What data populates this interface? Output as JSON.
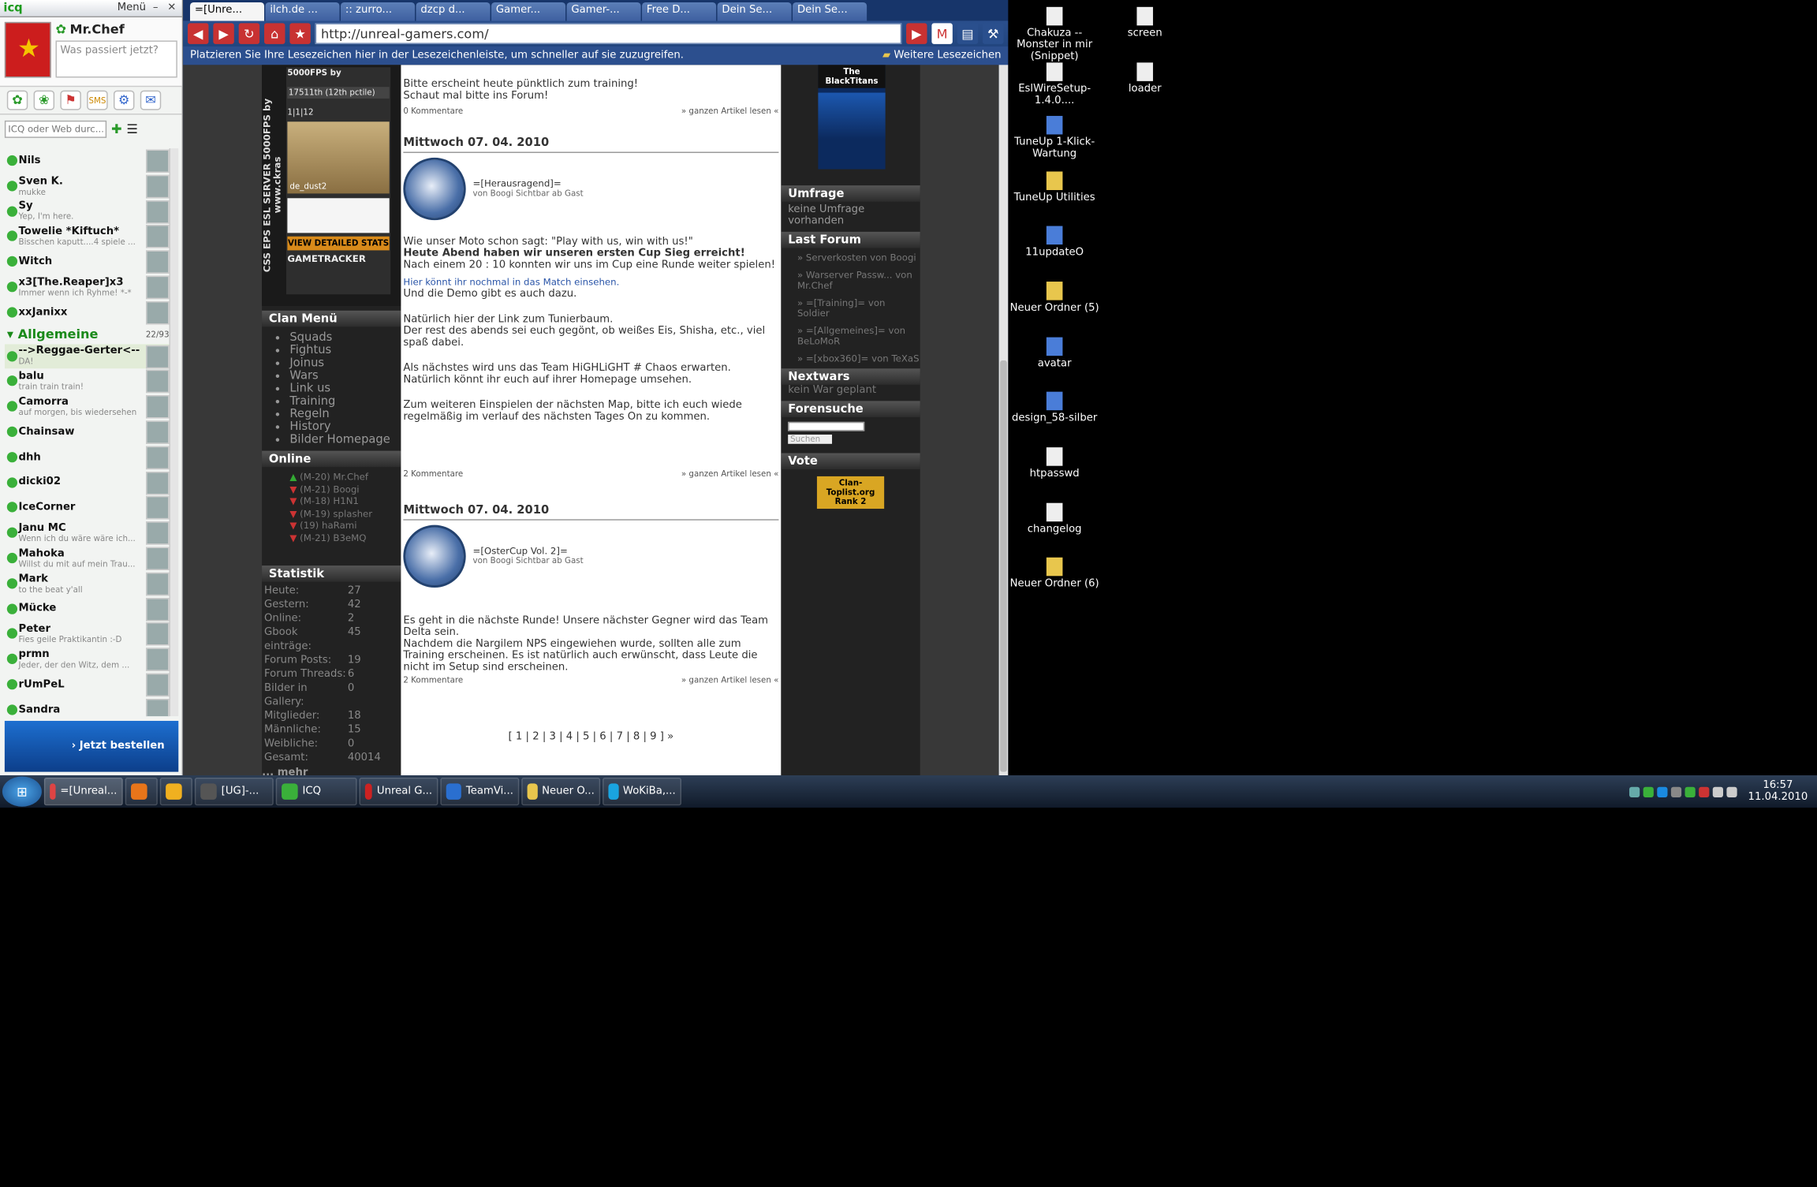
{
  "icq": {
    "logo": "icq",
    "menu_label": "Menü",
    "user_name": "Mr.Chef",
    "status_placeholder": "Was passiert jetzt?",
    "search_placeholder": "ICQ oder Web durc...",
    "contacts": [
      {
        "name": "Nils",
        "status": ""
      },
      {
        "name": "Sven K.",
        "status": "mukke"
      },
      {
        "name": "Sy",
        "status": "Yep, I'm here."
      },
      {
        "name": "Towelie *Kiftuch*",
        "status": "Bisschen kaputt....4 spiele ..."
      },
      {
        "name": "Witch",
        "status": ""
      },
      {
        "name": "x3[The.Reaper]x3",
        "status": "Immer wenn ich Ryhme! *-*"
      },
      {
        "name": "xxJanixx",
        "status": ""
      }
    ],
    "group": {
      "name": "Allgemeine",
      "count": "22/93"
    },
    "group_contacts": [
      {
        "name": "-->Reggae-Gerter<--",
        "status": "DA!"
      },
      {
        "name": "balu",
        "status": "train train train!"
      },
      {
        "name": "Camorra",
        "status": "auf morgen, bis wiedersehen"
      },
      {
        "name": "Chainsaw",
        "status": ""
      },
      {
        "name": "dhh",
        "status": ""
      },
      {
        "name": "dicki02",
        "status": ""
      },
      {
        "name": "IceCorner",
        "status": ""
      },
      {
        "name": "Janu MC",
        "status": "Wenn ich du wäre wäre ich..."
      },
      {
        "name": "Mahoka",
        "status": "Willst du mit auf mein Trau..."
      },
      {
        "name": "Mark",
        "status": "to the beat y'all"
      },
      {
        "name": "Mücke",
        "status": ""
      },
      {
        "name": "Peter",
        "status": "Fies geile Praktikantin :-D"
      },
      {
        "name": "prmn",
        "status": "Jeder, der den Witz, dem ..."
      },
      {
        "name": "rUmPeL",
        "status": ""
      },
      {
        "name": "Sandra",
        "status": ""
      }
    ],
    "ad_label": "› Jetzt bestellen"
  },
  "browser": {
    "tabs": [
      "=[Unre...",
      "ilch.de ...",
      ":: zurro...",
      "dzcp d...",
      "Gamer...",
      "Gamer-...",
      "Free D...",
      "Dein Se...",
      "Dein Se..."
    ],
    "url": "http://unreal-gamers.com/",
    "bookmarks_hint": "Platzieren Sie Ihre Lesezeichen hier in der Lesezeichenleiste, um schneller auf sie zuzugreifen.",
    "bookmarks_more": "Weitere Lesezeichen"
  },
  "page": {
    "gt": {
      "vertical": "CSS EPS ESL SERVER 5000FPS by www.ckras",
      "fps": "5000FPS by",
      "rank": "17511th (12th pctile)",
      "players": "1|1|12",
      "map": "de_dust2",
      "stats_button": "VIEW DETAILED STATS",
      "brand": "GAMETRACKER"
    },
    "clan_menu_title": "Clan Menü",
    "clan_menu": [
      "Squads",
      "Fightus",
      "Joinus",
      "Wars",
      "Link us",
      "Training",
      "Regeln",
      "History",
      "Bilder Homepage"
    ],
    "online_title": "Online",
    "online": [
      "(M-20) Mr.Chef",
      "(M-21) Boogi",
      "(M-18) H1N1",
      "(M-19) splasher",
      "(19) haRami",
      "(M-21) B3eMQ"
    ],
    "stat_title": "Statistik",
    "stats": [
      {
        "label": "Heute:",
        "value": "27"
      },
      {
        "label": "Gestern:",
        "value": "42"
      },
      {
        "label": "Online:",
        "value": "2"
      },
      {
        "label": "Gbook einträge:",
        "value": "45"
      },
      {
        "label": "Forum Posts:",
        "value": "19"
      },
      {
        "label": "Forum Threads:",
        "value": "6"
      },
      {
        "label": "Bilder in Gallery:",
        "value": "0"
      },
      {
        "label": "Mitglieder:",
        "value": "18"
      },
      {
        "label": "Männliche:",
        "value": "15"
      },
      {
        "label": "Weibliche:",
        "value": "0"
      },
      {
        "label": "Gesamt:",
        "value": "40014"
      }
    ],
    "stats_more": "... mehr",
    "top_text_1": "Bitte erscheint heute pünktlich zum training!",
    "top_text_2": "Schaut mal bitte ins Forum!",
    "comments_0": "0 Kommentare",
    "comments_2": "2 Kommentare",
    "full_article": "» ganzen Artikel lesen «",
    "news1": {
      "date": "Mittwoch 07. 04. 2010",
      "title": "=[Herausragend]=",
      "by": "von Boogi Sichtbar ab Gast",
      "p1": "Wie unser Moto schon sagt: \"Play with us, win with us!\"",
      "p2": "Heute Abend haben wir unseren ersten Cup Sieg erreicht!",
      "p3": "Nach einem 20 : 10 konnten wir uns im Cup eine Runde weiter spielen!",
      "p4": "Hier könnt ihr nochmal in das Match einsehen.",
      "p5": "Und die Demo gibt es auch dazu.",
      "p6": "Natürlich hier der Link zum Tunierbaum.",
      "p7": "Der rest des abends sei euch gegönt, ob weißes Eis, Shisha, etc., viel spaß dabei.",
      "p8": "Als nächstes wird uns das Team HiGHLiGHT # Chaos erwarten. Natürlich könnt ihr euch auf ihrer Homepage umsehen.",
      "p9": "Zum weiteren Einspielen der nächsten Map, bitte ich euch wiede regelmäßig im verlauf des nächsten Tages On zu kommen."
    },
    "news2": {
      "date": "Mittwoch 07. 04. 2010",
      "title": "=[OsterCup Vol. 2]=",
      "by": "von Boogi Sichtbar ab Gast",
      "p1": "Es geht in die nächste Runde! Unsere nächster Gegner wird das Team Delta sein.",
      "p2": "Nachdem die Nargilem NPS eingewiehen wurde, sollten alle zum Training erscheinen. Es ist natürlich auch erwünscht, dass Leute die nicht im Setup sind erscheinen."
    },
    "pagination": "[ 1 | 2 | 3 | 4 | 5 | 6 | 7 | 8 | 9 ] »",
    "right_banner": "The BlackTitans",
    "umfrage_title": "Umfrage",
    "umfrage_text": "keine Umfrage vorhanden",
    "forum_title": "Last Forum",
    "forum_items": [
      "» Serverkosten von Boogi",
      "» Warserver Passw... von Mr.Chef",
      "» =[Training]= von Soldier",
      "» =[Allgemeines]= von BeLoMoR",
      "» =[xbox360]= von TeXaS"
    ],
    "nextwars_title": "Nextwars",
    "nextwars_text": "kein War geplant",
    "forensuche_title": "Forensuche",
    "search_button": "Suchen",
    "vote_title": "Vote",
    "toplist": "Clan-Toplist.org",
    "toplist_rank": "Rank 2"
  },
  "desktop": {
    "icons": [
      "Chakuza -- Monster in mir (Snippet)",
      "screen",
      "EslWireSetup-1.4.0....",
      "loader",
      "TuneUp 1-Klick-Wartung",
      "TuneUp Utilities",
      "11updateO",
      "Neuer Ordner (5)",
      "avatar",
      "design_58-silber",
      "htpasswd",
      "changelog",
      "Neuer Ordner (6)"
    ]
  },
  "taskbar": {
    "items": [
      "=[Unreal...",
      "[UG]-...",
      "ICQ",
      "Unreal G...",
      "TeamVi...",
      "Neuer O...",
      "WoKiBa,..."
    ],
    "time": "16:57",
    "date": "11.04.2010"
  }
}
